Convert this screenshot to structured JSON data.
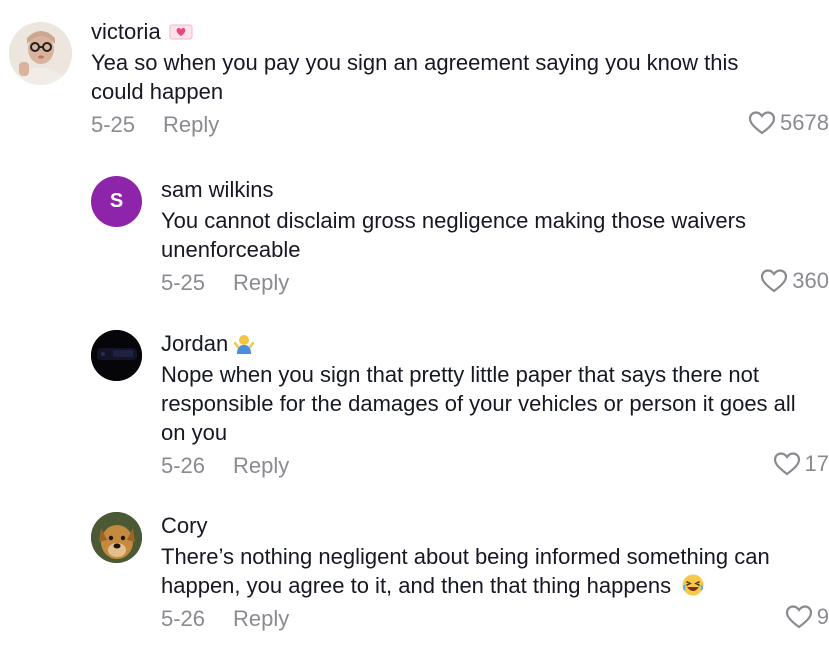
{
  "comments": [
    {
      "username": "victoria",
      "text": "Yea so when you pay you sign an agreement saying you know this could happen",
      "date": "5-25",
      "reply_label": "Reply",
      "likes": "5678",
      "badge_icon": "love-letter-emoji-icon"
    },
    {
      "username": "sam wilkins",
      "text": "You cannot disclaim gross negligence making those waivers unenforceable",
      "date": "5-25",
      "reply_label": "Reply",
      "likes": "360",
      "avatar_letter": "S",
      "avatar_color": "#8e24aa"
    },
    {
      "username": "Jordan",
      "text": "Nope when you sign that pretty little paper that says there not responsible for the damages of your vehicles or person it goes all on you",
      "date": "5-26",
      "reply_label": "Reply",
      "likes": "17",
      "badge_icon": "person-shrugging-emoji-icon"
    },
    {
      "username": "Cory",
      "text": "There’s nothing negligent about being informed something can happen, you agree to it, and then that thing happens",
      "date": "5-26",
      "reply_label": "Reply",
      "likes": "9",
      "trailing_icon": "laughing-face-emoji-icon"
    }
  ]
}
